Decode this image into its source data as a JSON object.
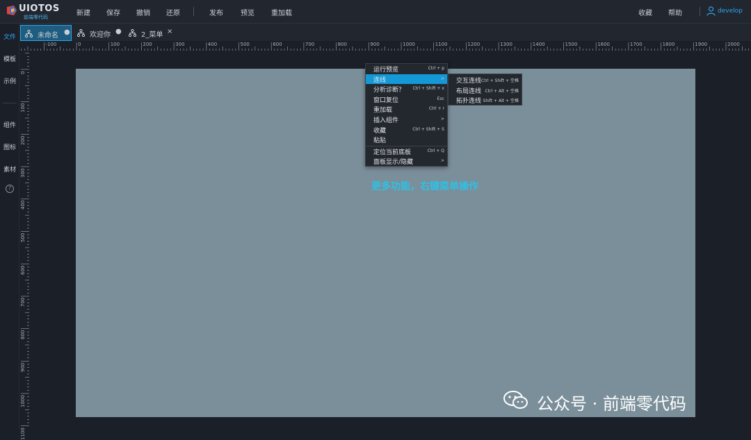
{
  "app": {
    "logo_text": "UIOTOS",
    "logo_sub": "前端零代码"
  },
  "toolbar": {
    "items": [
      "新建",
      "保存",
      "撤销",
      "还原",
      "发布",
      "预览",
      "重加载"
    ],
    "right_items": [
      "收藏",
      "帮助"
    ],
    "user": "develop"
  },
  "sidebar": {
    "items": [
      "文件",
      "模板",
      "示例",
      "组件",
      "图标",
      "素材"
    ],
    "help_glyph": "?"
  },
  "tabs": [
    {
      "label": "未命名",
      "mark": "●",
      "active": true
    },
    {
      "label": "欢迎你",
      "mark": "●",
      "active": false
    },
    {
      "label": "2_菜单",
      "mark": "×",
      "active": false
    }
  ],
  "ruler": {
    "h_labels": [
      "-100",
      "0",
      "100",
      "200",
      "300",
      "400",
      "500",
      "600",
      "700",
      "800",
      "900",
      "1000",
      "1100",
      "1200",
      "1300",
      "1400",
      "1500",
      "1600",
      "1700",
      "1800",
      "1900",
      "2000"
    ],
    "v_labels": [
      "0",
      "100",
      "200",
      "300",
      "400",
      "500",
      "600",
      "700",
      "800",
      "900",
      "1000",
      "1100"
    ]
  },
  "canvas": {
    "hint": "更多功能，右键菜单操作",
    "board_color": "#7b8f9a",
    "accent": "#2ea6f0",
    "hint_color": "#2cc1e6"
  },
  "context_menu": {
    "items": [
      {
        "label": "运行预览",
        "key": "Ctrl + p"
      },
      {
        "label": "连线",
        "key": ">",
        "highlight": true
      },
      {
        "label": "分析诊断？",
        "key": "Ctrl + Shift + x"
      },
      {
        "label": "窗口复位",
        "key": "Esc"
      },
      {
        "label": "重加载",
        "key": "Ctrl + r"
      },
      {
        "label": "插入组件",
        "key": ">"
      },
      {
        "label": "收藏",
        "key": "Ctrl + Shift + S"
      },
      {
        "label": "粘贴",
        "key": ""
      },
      {
        "label": "定位当前底板",
        "key": "Ctrl + Q"
      },
      {
        "label": "面板显示/隐藏",
        "key": ">"
      }
    ],
    "submenu": [
      {
        "label": "交互连线",
        "key": "Ctrl + Shift + 空格"
      },
      {
        "label": "布局连线",
        "key": "Ctrl + Alt + 空格"
      },
      {
        "label": "拓扑连线",
        "key": "Shift + Alt + 空格"
      }
    ]
  },
  "watermark": {
    "text": "公众号 · 前端零代码"
  }
}
